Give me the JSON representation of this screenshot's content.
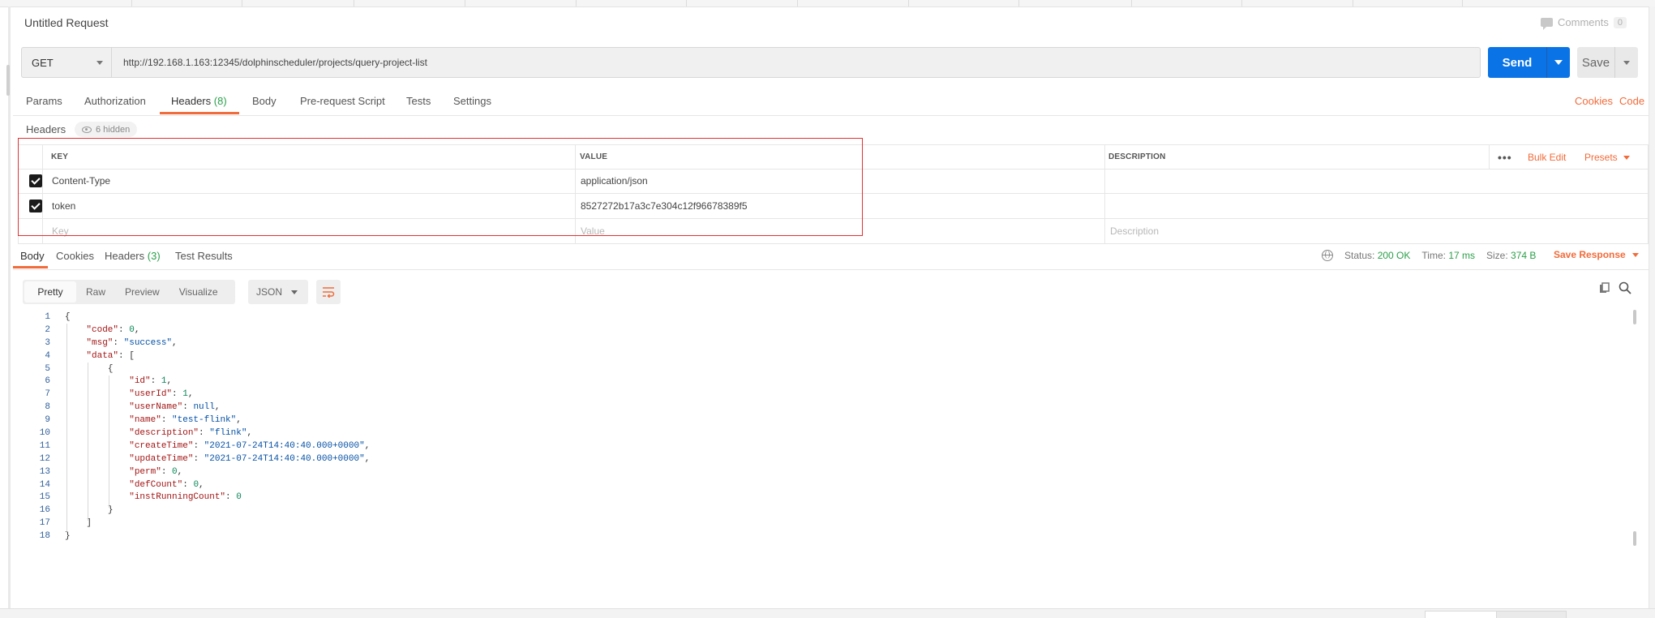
{
  "request": {
    "title": "Untitled Request",
    "comments_label": "Comments",
    "comments_count": "0",
    "method": "GET",
    "url": "http://192.168.1.163:12345/dolphinscheduler/projects/query-project-list",
    "send_label": "Send",
    "save_label": "Save"
  },
  "request_tabs": [
    {
      "label": "Params"
    },
    {
      "label": "Authorization"
    },
    {
      "label": "Headers",
      "count": "(8)"
    },
    {
      "label": "Body"
    },
    {
      "label": "Pre-request Script"
    },
    {
      "label": "Tests"
    },
    {
      "label": "Settings"
    }
  ],
  "request_links": {
    "cookies": "Cookies",
    "code": "Code"
  },
  "headers": {
    "label": "Headers",
    "hidden_label": "6 hidden",
    "columns": {
      "key": "KEY",
      "value": "VALUE",
      "description": "DESCRIPTION"
    },
    "more_label": "•••",
    "bulk_edit_label": "Bulk Edit",
    "presets_label": "Presets",
    "rows": [
      {
        "key": "Content-Type",
        "value": "application/json",
        "checked": true
      },
      {
        "key": "token",
        "value": "8527272b17a3c7e304c12f96678389f5",
        "checked": true
      }
    ],
    "placeholder": {
      "key": "Key",
      "value": "Value",
      "description": "Description"
    }
  },
  "response_tabs": [
    {
      "label": "Body"
    },
    {
      "label": "Cookies"
    },
    {
      "label": "Headers",
      "count": "(3)"
    },
    {
      "label": "Test Results"
    }
  ],
  "response_status": {
    "status_label": "Status:",
    "status_value": "200 OK",
    "time_label": "Time:",
    "time_value": "17 ms",
    "size_label": "Size:",
    "size_value": "374 B",
    "save_response_label": "Save Response"
  },
  "body_toolbar": {
    "formats": [
      "Pretty",
      "Raw",
      "Preview",
      "Visualize"
    ],
    "language": "JSON"
  },
  "colors": {
    "accent": "#f26b3a",
    "send_blue": "#0a73e6",
    "ok_green": "#2a9f4a",
    "highlight_red": "#e03131"
  },
  "icons": [
    "comment-icon",
    "eye-icon",
    "globe-icon",
    "wrap-icon",
    "copy-icon",
    "search-icon"
  ],
  "code_lines": [
    {
      "indent": 0,
      "tokens": [
        [
          "p",
          "{"
        ]
      ]
    },
    {
      "indent": 1,
      "tokens": [
        [
          "k",
          "\"code\""
        ],
        [
          "p",
          ": "
        ],
        [
          "n",
          "0"
        ],
        [
          "p",
          ","
        ]
      ]
    },
    {
      "indent": 1,
      "tokens": [
        [
          "k",
          "\"msg\""
        ],
        [
          "p",
          ": "
        ],
        [
          "s",
          "\"success\""
        ],
        [
          "p",
          ","
        ]
      ]
    },
    {
      "indent": 1,
      "tokens": [
        [
          "k",
          "\"data\""
        ],
        [
          "p",
          ": ["
        ]
      ]
    },
    {
      "indent": 2,
      "tokens": [
        [
          "p",
          "{"
        ]
      ]
    },
    {
      "indent": 3,
      "tokens": [
        [
          "k",
          "\"id\""
        ],
        [
          "p",
          ": "
        ],
        [
          "n",
          "1"
        ],
        [
          "p",
          ","
        ]
      ]
    },
    {
      "indent": 3,
      "tokens": [
        [
          "k",
          "\"userId\""
        ],
        [
          "p",
          ": "
        ],
        [
          "n",
          "1"
        ],
        [
          "p",
          ","
        ]
      ]
    },
    {
      "indent": 3,
      "tokens": [
        [
          "k",
          "\"userName\""
        ],
        [
          "p",
          ": "
        ],
        [
          "nl",
          "null"
        ],
        [
          "p",
          ","
        ]
      ]
    },
    {
      "indent": 3,
      "tokens": [
        [
          "k",
          "\"name\""
        ],
        [
          "p",
          ": "
        ],
        [
          "s",
          "\"test-flink\""
        ],
        [
          "p",
          ","
        ]
      ]
    },
    {
      "indent": 3,
      "tokens": [
        [
          "k",
          "\"description\""
        ],
        [
          "p",
          ": "
        ],
        [
          "s",
          "\"flink\""
        ],
        [
          "p",
          ","
        ]
      ]
    },
    {
      "indent": 3,
      "tokens": [
        [
          "k",
          "\"createTime\""
        ],
        [
          "p",
          ": "
        ],
        [
          "s",
          "\"2021-07-24T14:40:40.000+0000\""
        ],
        [
          "p",
          ","
        ]
      ]
    },
    {
      "indent": 3,
      "tokens": [
        [
          "k",
          "\"updateTime\""
        ],
        [
          "p",
          ": "
        ],
        [
          "s",
          "\"2021-07-24T14:40:40.000+0000\""
        ],
        [
          "p",
          ","
        ]
      ]
    },
    {
      "indent": 3,
      "tokens": [
        [
          "k",
          "\"perm\""
        ],
        [
          "p",
          ": "
        ],
        [
          "n",
          "0"
        ],
        [
          "p",
          ","
        ]
      ]
    },
    {
      "indent": 3,
      "tokens": [
        [
          "k",
          "\"defCount\""
        ],
        [
          "p",
          ": "
        ],
        [
          "n",
          "0"
        ],
        [
          "p",
          ","
        ]
      ]
    },
    {
      "indent": 3,
      "tokens": [
        [
          "k",
          "\"instRunningCount\""
        ],
        [
          "p",
          ": "
        ],
        [
          "n",
          "0"
        ]
      ]
    },
    {
      "indent": 2,
      "tokens": [
        [
          "p",
          "}"
        ]
      ]
    },
    {
      "indent": 1,
      "tokens": [
        [
          "p",
          "]"
        ]
      ]
    },
    {
      "indent": 0,
      "tokens": [
        [
          "p",
          "}"
        ]
      ]
    }
  ]
}
